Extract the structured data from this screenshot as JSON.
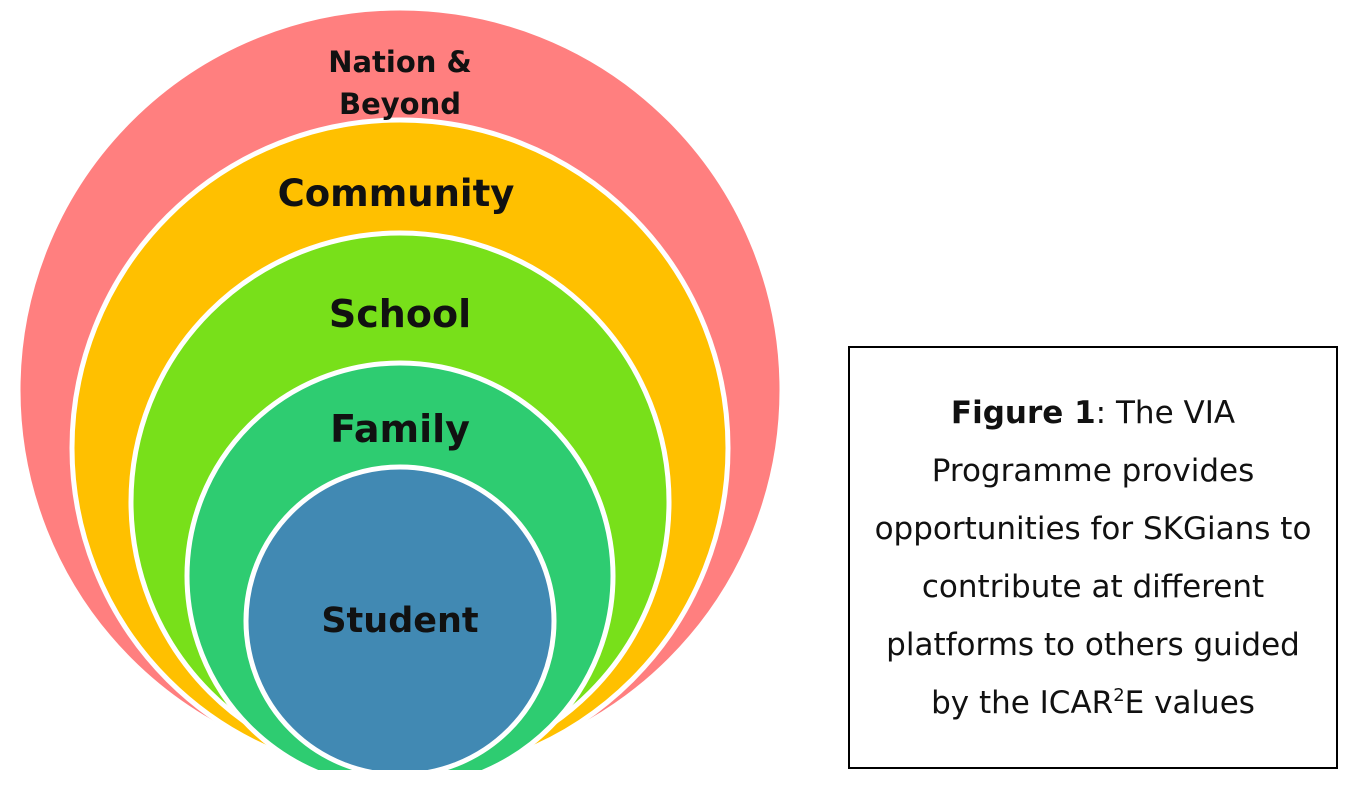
{
  "diagram": {
    "rings": [
      {
        "label_lines": [
          "Nation &",
          "Beyond"
        ],
        "color": "#FF7F7F"
      },
      {
        "label_lines": [
          "Community"
        ],
        "color": "#FFC000"
      },
      {
        "label_lines": [
          "School"
        ],
        "color": "#78E01A"
      },
      {
        "label_lines": [
          "Family"
        ],
        "color": "#2ECC71"
      },
      {
        "label_lines": [
          "Student"
        ],
        "color": "#4189B3"
      }
    ],
    "ring_stroke_color": "#FFFFFF"
  },
  "caption": {
    "figure_label": "Figure 1",
    "separator": ": ",
    "text_before_superscript": "The VIA Programme provides opportunities for SKGians to contribute at different platforms to others guided by the ICAR",
    "superscript": "2",
    "text_after_superscript": "E values"
  }
}
